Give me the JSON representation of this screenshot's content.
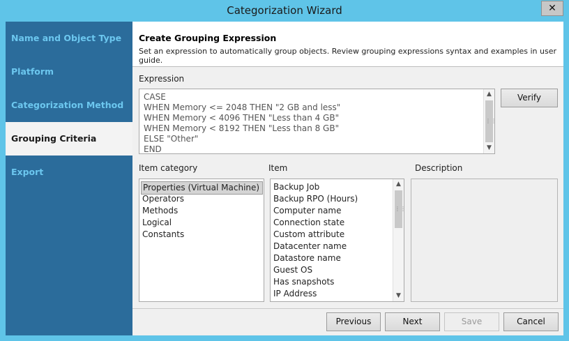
{
  "window": {
    "title": "Categorization Wizard",
    "close_glyph": "✕"
  },
  "sidebar": {
    "items": [
      {
        "label": "Name and Object Type",
        "active": false
      },
      {
        "label": "Platform",
        "active": false
      },
      {
        "label": "Categorization Method",
        "active": false
      },
      {
        "label": "Grouping Criteria",
        "active": true
      },
      {
        "label": "Export",
        "active": false
      }
    ]
  },
  "header": {
    "title": "Create Grouping Expression",
    "description": "Set an expression to automatically group objects. Review grouping expressions syntax and examples in user guide."
  },
  "expression": {
    "label": "Expression",
    "lines": [
      "CASE",
      "WHEN Memory <= 2048 THEN \"2 GB and less\"",
      "WHEN Memory < 4096 THEN \"Less than 4 GB\"",
      "WHEN Memory < 8192 THEN \"Less than 8 GB\"",
      "ELSE \"Other\"",
      "END"
    ],
    "verify_label": "Verify"
  },
  "item_category": {
    "label": "Item category",
    "selected": "Properties (Virtual Machine)",
    "items": [
      "Properties (Virtual Machine)",
      "Operators",
      "Methods",
      "Logical",
      "Constants"
    ]
  },
  "item": {
    "label": "Item",
    "items": [
      "Backup Job",
      "Backup RPO (Hours)",
      "Computer name",
      "Connection state",
      "Custom attribute",
      "Datacenter name",
      "Datastore name",
      "Guest OS",
      "Has snapshots",
      "IP Address"
    ]
  },
  "description": {
    "label": "Description",
    "text": ""
  },
  "footer": {
    "previous_label": "Previous",
    "next_label": "Next",
    "save_label": "Save",
    "save_enabled": false,
    "cancel_label": "Cancel"
  },
  "colors": {
    "window_frame": "#5fc4e8",
    "sidebar_bg": "#2b6c9b",
    "sidebar_text": "#6cc7ef",
    "sidebar_active_bg": "#f3f3f3"
  }
}
